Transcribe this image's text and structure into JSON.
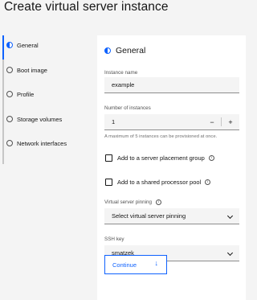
{
  "page": {
    "title": "Create virtual server instance"
  },
  "sidebar": {
    "steps": [
      {
        "label": "General",
        "state": "current"
      },
      {
        "label": "Boot image",
        "state": "incomplete"
      },
      {
        "label": "Profile",
        "state": "incomplete"
      },
      {
        "label": "Storage volumes",
        "state": "incomplete"
      },
      {
        "label": "Network interfaces",
        "state": "incomplete"
      }
    ]
  },
  "form": {
    "section_title": "General",
    "instance_name": {
      "label": "Instance name",
      "value": "example"
    },
    "number_of_instances": {
      "label": "Number of instances",
      "value": "1",
      "decrement": "−",
      "increment": "+",
      "helper": "A maximum of 5 instances can be provisioned at once."
    },
    "placement_group": {
      "label": "Add to a server placement group",
      "checked": false
    },
    "shared_pool": {
      "label": "Add to a shared processor pool",
      "checked": false
    },
    "vs_pinning": {
      "label": "Virtual server pinning",
      "value": "Select virtual server pinning"
    },
    "ssh_key": {
      "label": "SSH key",
      "value": "smatzek"
    },
    "continue_label": "Continue",
    "continue_arrow": "↓",
    "info_glyph": "i"
  },
  "colors": {
    "accent": "#0f62fe",
    "panel_bg": "#ffffff",
    "page_bg": "#f4f4f4"
  }
}
